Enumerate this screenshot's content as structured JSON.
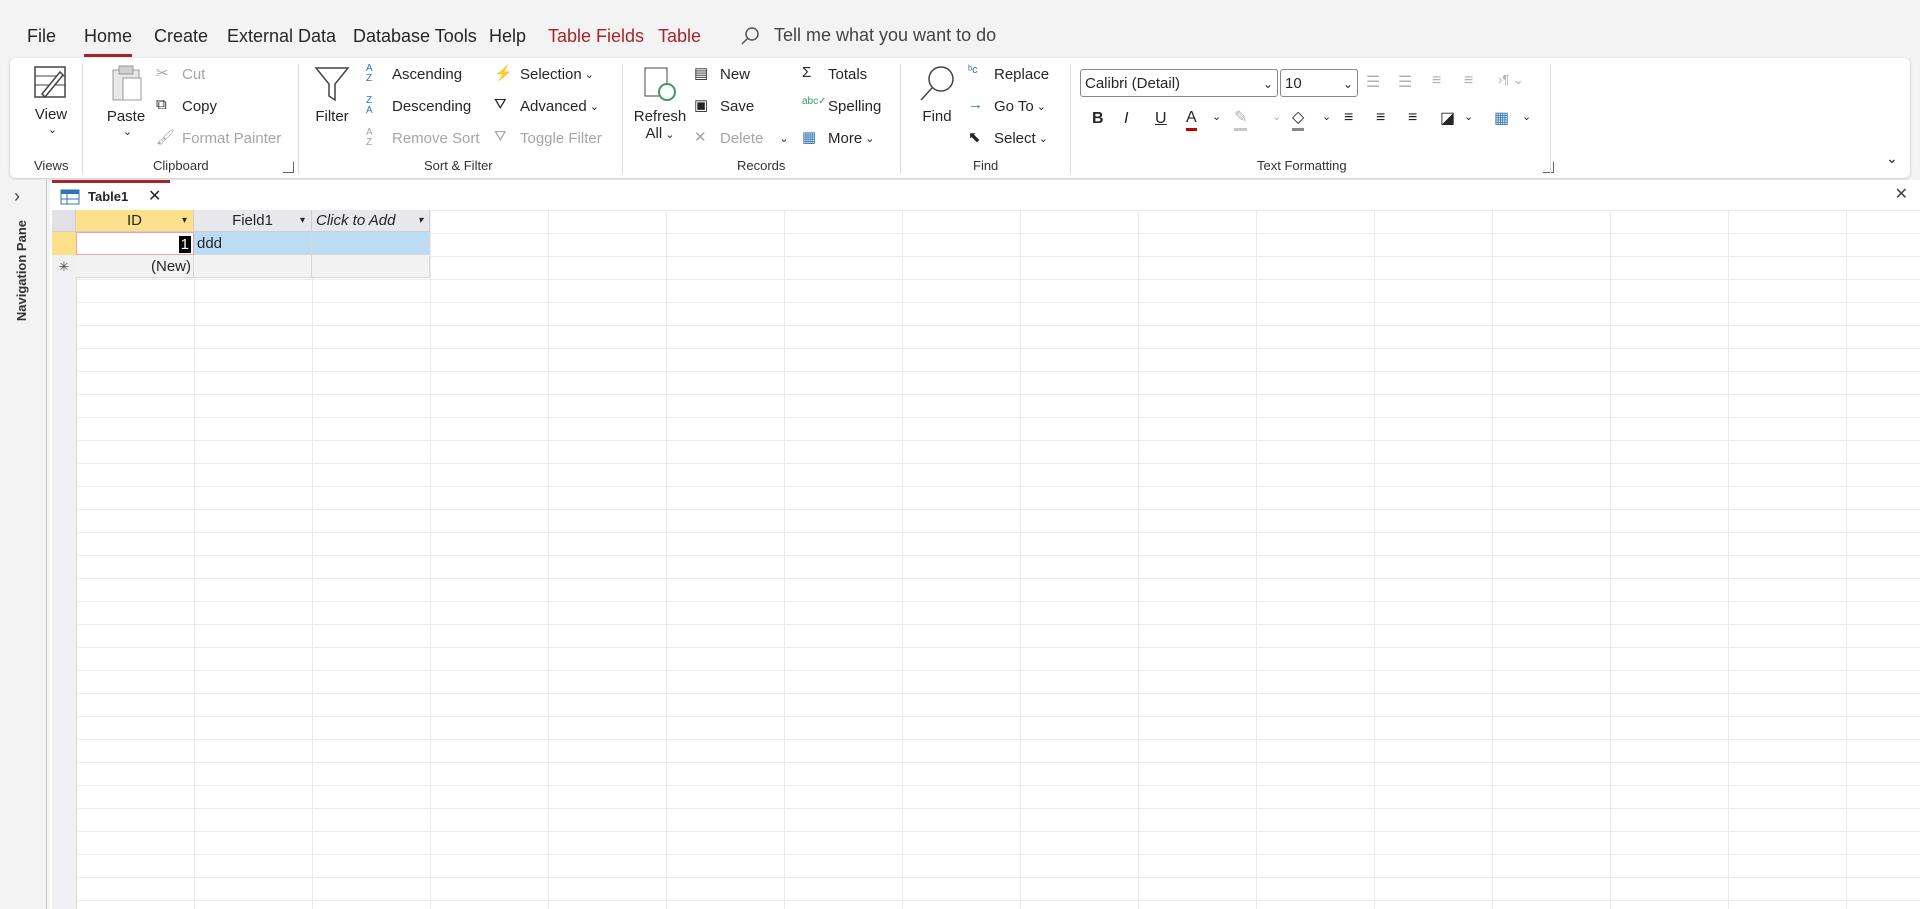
{
  "menu": {
    "tabs": [
      {
        "label": "File"
      },
      {
        "label": "Home"
      },
      {
        "label": "Create"
      },
      {
        "label": "External Data"
      },
      {
        "label": "Database Tools"
      },
      {
        "label": "Help"
      },
      {
        "label": "Table Fields"
      },
      {
        "label": "Table"
      }
    ],
    "active_tab": "Home",
    "tell_me": "Tell me what you want to do"
  },
  "ribbon": {
    "views": {
      "view": "View",
      "group": "Views"
    },
    "clipboard": {
      "paste": "Paste",
      "cut": "Cut",
      "copy": "Copy",
      "format_painter": "Format Painter",
      "group": "Clipboard"
    },
    "sort_filter": {
      "filter": "Filter",
      "ascending": "Ascending",
      "descending": "Descending",
      "remove_sort": "Remove Sort",
      "selection": "Selection",
      "advanced": "Advanced",
      "toggle_filter": "Toggle Filter",
      "group": "Sort & Filter"
    },
    "records": {
      "refresh": "Refresh",
      "refresh_all": "All",
      "new": "New",
      "save": "Save",
      "delete": "Delete",
      "totals": "Totals",
      "spelling": "Spelling",
      "more": "More",
      "group": "Records"
    },
    "find": {
      "find": "Find",
      "replace": "Replace",
      "go_to": "Go To",
      "select": "Select",
      "group": "Find"
    },
    "text_formatting": {
      "font": "Calibri (Detail)",
      "size": "10",
      "bold": "B",
      "italic": "I",
      "underline": "U",
      "group": "Text Formatting"
    }
  },
  "navigation_pane": {
    "label": "Navigation Pane"
  },
  "document": {
    "tab": "Table1"
  },
  "table": {
    "columns": [
      "ID",
      "Field1",
      "Click to Add"
    ],
    "rows": [
      {
        "id": "1",
        "field1": "ddd"
      }
    ],
    "new_row": "(New)"
  },
  "colors": {
    "accent": "#a4262c",
    "selected_header": "#fde08a",
    "selected_cell": "#bcdcf4"
  }
}
